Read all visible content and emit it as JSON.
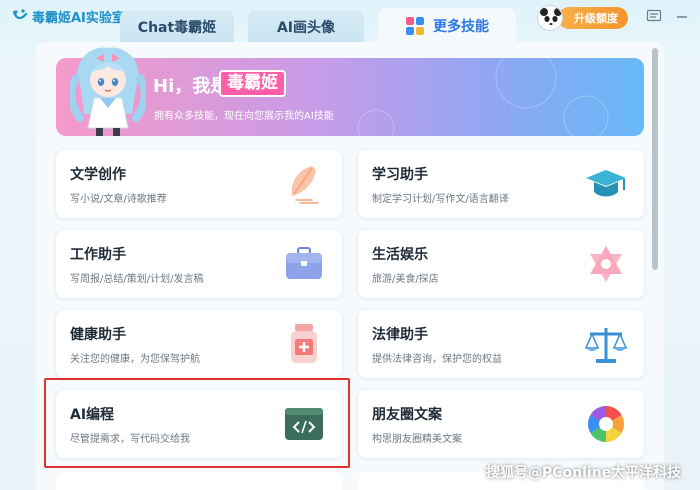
{
  "app": {
    "title": "毒霸姬AI实验室"
  },
  "tabs": [
    {
      "label": "Chat毒霸姬",
      "active": false
    },
    {
      "label": "AI画头像",
      "active": false
    },
    {
      "label": "更多技能",
      "active": true
    }
  ],
  "header": {
    "upgrade_label": "升级额度"
  },
  "banner": {
    "greeting": "Hi，我是",
    "name": "毒霸姬",
    "subtitle": "拥有众多技能，现在向您展示我的AI技能"
  },
  "skills": [
    {
      "title": "文学创作",
      "desc": "写小说/文章/诗歌推荐",
      "icon": "quill-icon"
    },
    {
      "title": "学习助手",
      "desc": "制定学习计划/写作文/语言翻译",
      "icon": "graduation-cap-icon"
    },
    {
      "title": "工作助手",
      "desc": "写周报/总结/策划/计划/发言稿",
      "icon": "briefcase-icon"
    },
    {
      "title": "生活娱乐",
      "desc": "旅游/美食/探店",
      "icon": "star-of-david-icon"
    },
    {
      "title": "健康助手",
      "desc": "关注您的健康，为您保驾护航",
      "icon": "medicine-bottle-icon"
    },
    {
      "title": "法律助手",
      "desc": "提供法律咨询，保护您的权益",
      "icon": "scales-icon"
    },
    {
      "title": "AI编程",
      "desc": "尽管提需求，写代码交给我",
      "icon": "code-icon"
    },
    {
      "title": "朋友圈文案",
      "desc": "构思朋友圈精美文案",
      "icon": "aperture-icon"
    }
  ],
  "watermark": "搜狐号@PConline太平洋科技",
  "colors": {
    "accent": "#2e78e6",
    "brand": "#1e90c9",
    "upgrade": "#f3962b",
    "highlight": "#e03131"
  }
}
